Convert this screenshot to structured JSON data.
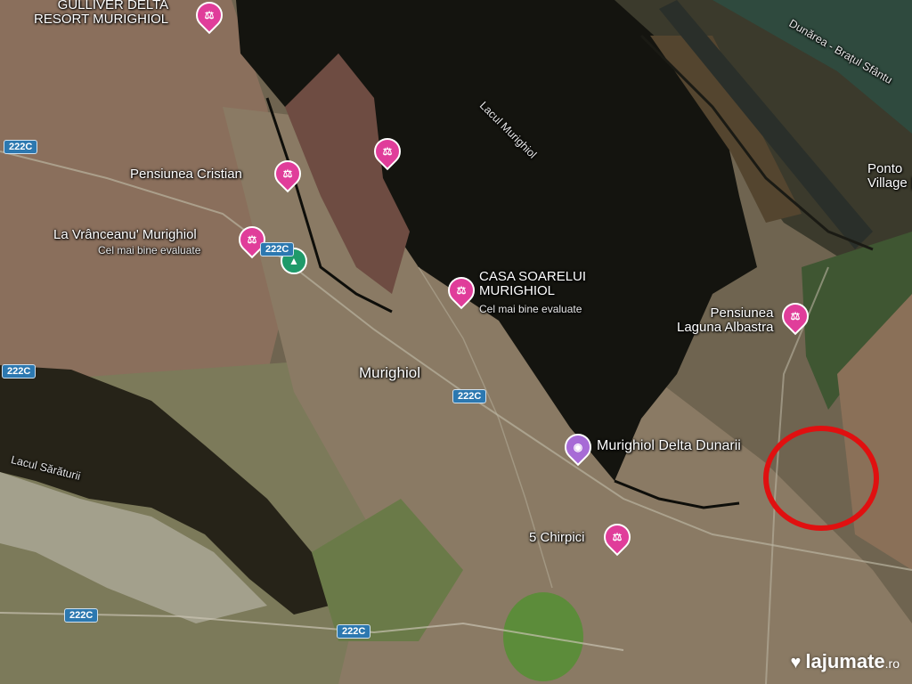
{
  "map": {
    "places": {
      "gulliver": {
        "line1": "GULLIVER DELTA",
        "line2": "RESORT MURIGHIOL"
      },
      "cristian": "Pensiunea Cristian",
      "vranceanu": {
        "name": "La Vrânceanu' Murighiol",
        "note": "Cel mai bine evaluate"
      },
      "casa_soarelui": {
        "line1": "CASA SOARELUI",
        "line2": "MURIGHIOL",
        "note": "Cel mai bine evaluate"
      },
      "laguna": {
        "line1": "Pensiunea",
        "line2": "Laguna Albastra"
      },
      "delta_dunarii": "Murighiol Delta Dunarii",
      "chirpici": "5 Chirpici",
      "ponto": {
        "line1": "Ponto",
        "line2": "Village | St"
      },
      "town": "Murighiol"
    },
    "water": {
      "lacul_murighiol": "Lacul Murighiol",
      "lacul_saraturii": "Lacul Sărăturii",
      "dunarea": "Dunărea - Brațul Sfântu"
    },
    "roads": [
      "222C",
      "222C",
      "222C",
      "222C",
      "222C",
      "222C"
    ],
    "icons": {
      "hotel": "hotel-bed-icon",
      "camera": "camera-icon",
      "park": "park-triangle-icon"
    },
    "highlight_color": "#e01010",
    "watermark": {
      "brand": "lajumate",
      "tld": ".ro"
    }
  }
}
